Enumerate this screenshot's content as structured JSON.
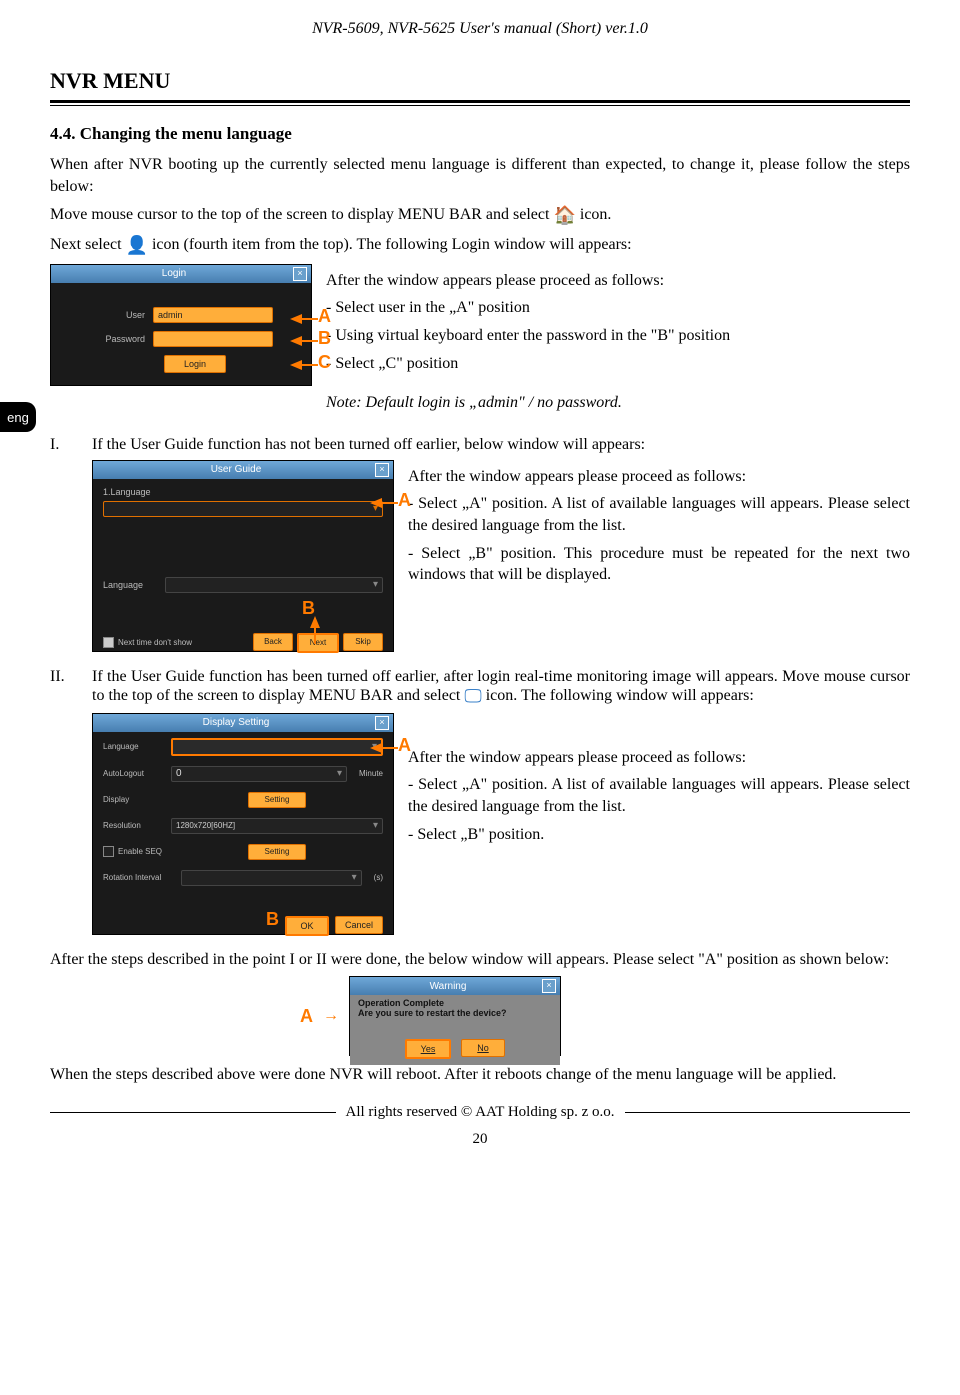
{
  "header": "NVR-5609, NVR-5625 User's manual (Short) ver.1.0",
  "page_heading": "NVR MENU",
  "lang_tab": "eng",
  "section": {
    "number_title": "4.4. Changing the menu language",
    "intro": "When after NVR booting up the currently selected menu language is different than expected, to change it, please follow the steps below:",
    "move_cursor_pre": "Move mouse cursor to the top of the screen to display MENU BAR and select ",
    "move_cursor_post": " icon.",
    "next_select_pre": "Next select ",
    "next_select_post": " icon (fourth item from the top). The following Login window will appears:"
  },
  "login_shot": {
    "title": "Login",
    "user_label": "User",
    "user_value": "admin",
    "password_label": "Password",
    "login_btn": "Login",
    "callouts": {
      "a": "A",
      "b": "B",
      "c": "C"
    }
  },
  "login_steps": {
    "lead": "After the window appears please proceed as follows:",
    "s1": "- Select user in the „A\" position",
    "s2": "- Using virtual keyboard enter the password in the \"B\" position",
    "s3": "- Select „C\" position",
    "note": "Note: Default login is „admin\" / no password."
  },
  "sectionI": {
    "rn": "I.",
    "text": "If the User Guide function has not been turned off earlier, below window will appears:"
  },
  "guide_shot": {
    "title": "User Guide",
    "top_label": "1.Language",
    "lang_label": "Language",
    "checkbox": "Next time don't show",
    "btn_back": "Back",
    "btn_next": "Next",
    "btn_skip": "Skip",
    "callouts": {
      "a": "A",
      "b": "B"
    }
  },
  "guide_steps": {
    "lead": "After the window appears please proceed as follows:",
    "s1": "- Select „A\" position. A list of available languages will appears. Please select the desired language from the list.",
    "s2": "- Select „B\" position. This procedure must be repeated for the next two windows that will be displayed."
  },
  "sectionII": {
    "rn": "II.",
    "text_pre": "If the User Guide function has been turned off earlier, after login real-time monitoring image will appears. Move mouse cursor to the top of the screen to display MENU BAR and select ",
    "text_post": " icon. The following window will appears:"
  },
  "disp_shot": {
    "title": "Display Setting",
    "rows": {
      "language": "Language",
      "autologout": "AutoLogout",
      "autologout_val": "0",
      "autologout_unit": "Minute",
      "display": "Display",
      "display_btn": "Setting",
      "resolution": "Resolution",
      "resolution_val": "1280x720[60HZ]",
      "enable_seq": "Enable SEQ",
      "enable_seq_btn": "Setting",
      "rotation": "Rotation Interval",
      "rotation_unit": "(s)"
    },
    "btn_ok": "OK",
    "btn_cancel": "Cancel",
    "callouts": {
      "a": "A",
      "b": "B"
    }
  },
  "disp_steps": {
    "lead": "After the window appears please proceed as follows:",
    "s1": "- Select „A\" position. A list of available languages will appears. Please select the desired language from the list.",
    "s2": "- Select „B\" position."
  },
  "after_steps": "After the steps described in the point I or II were done, the below window will appears. Please select \"A\" position as shown below:",
  "warn_shot": {
    "title": "Warning",
    "line1": "Operation Complete",
    "line2": "Are you sure to restart the device?",
    "btn_yes": "Yes",
    "btn_no": "No",
    "callout_a": "A"
  },
  "closing": "When the steps described above were done NVR will reboot. After it reboots change of the menu language will be applied.",
  "footer": "All rights reserved © AAT Holding sp. z o.o.",
  "page_number": "20"
}
